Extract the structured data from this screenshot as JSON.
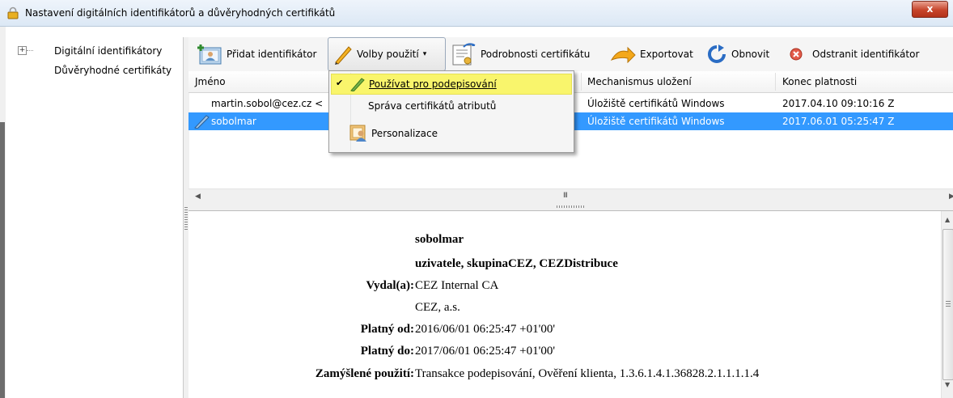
{
  "window": {
    "title": "Nastavení digitálních identifikátorů a důvěryhodných certifikátů",
    "close_label": "x"
  },
  "tree": {
    "expander": "+",
    "items": [
      {
        "label": "Digitální identifikátory"
      },
      {
        "label": "Důvěryhodné certifikáty"
      }
    ]
  },
  "toolbar": {
    "add": "Přidat identifikátor",
    "usage": "Volby použití",
    "usage_arrow": "▾",
    "details": "Podrobnosti certifikátu",
    "export": "Exportovat",
    "refresh": "Obnovit",
    "remove": "Odstranit identifikátor"
  },
  "table": {
    "columns": [
      "Jméno",
      "Mechanismus uložení",
      "Konec platnosti"
    ],
    "rows": [
      {
        "name": "martin.sobol@cez.cz <",
        "storage": "Úložiště certifikátů Windows",
        "expires": "2017.04.10 09:10:16 Z"
      },
      {
        "name": "sobolmar",
        "storage": "Úložiště certifikátů Windows",
        "expires": "2017.06.01 05:25:47 Z"
      }
    ],
    "scroll_mark": "III"
  },
  "menu": {
    "items": [
      {
        "label": "Používat pro podepisování",
        "checked": true
      },
      {
        "label": "Správa certifikátů atributů"
      },
      {
        "label": "Personalizace"
      }
    ],
    "check": "✔"
  },
  "details": {
    "name": "sobolmar",
    "org": "uzivatele, skupinaCEZ, CEZDistribuce",
    "issued_by_label": "Vydal(a):",
    "issued_by": "CEZ Internal CA",
    "issued_by_org": "CEZ, a.s.",
    "valid_from_label": "Platný od:",
    "valid_from": "2016/06/01 06:25:47 +01'00'",
    "valid_to_label": "Platný do:",
    "valid_to": "2017/06/01 06:25:47 +01'00'",
    "intended_use_label": "Zamýšlené použití:",
    "intended_use": "Transakce podepisování, Ověření klienta, 1.3.6.1.4.1.36828.2.1.1.1.1.4"
  },
  "colors": {
    "selection": "#3399ff",
    "menu_highlight": "#f9f56c"
  }
}
